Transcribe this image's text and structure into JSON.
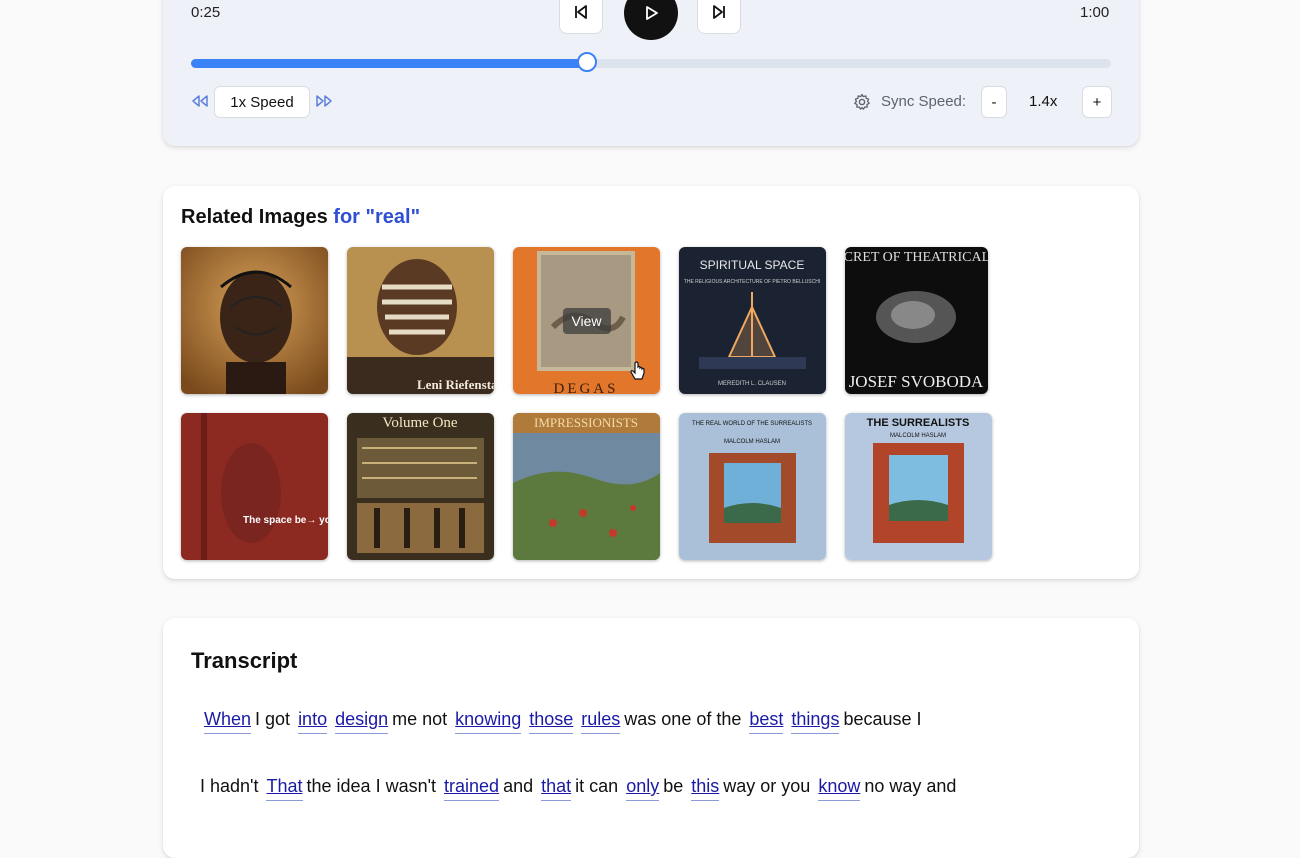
{
  "player": {
    "current_time": "0:25",
    "total_time": "1:00",
    "progress": 0.43,
    "speed_label": "1x Speed",
    "sync_label": "Sync Speed:",
    "sync_minus": "-",
    "sync_value": "1.4x",
    "sync_plus": "+",
    "accent_color": "#3b82f6"
  },
  "images": {
    "title": "Related Images",
    "query": "for \"real\"",
    "hover_label": "View",
    "row1": [
      {
        "title": ""
      },
      {
        "title": "Leni Riefenstahl"
      },
      {
        "title": "DEGAS"
      },
      {
        "title": "SPIRITUAL SPACE",
        "subtitle": "THE RELIGIOUS ARCHITECTURE OF PIETRO BELLUSCHI",
        "author": "MEREDITH L. CLAUSEN"
      },
      {
        "title": "THE SECRET OF THEATRICAL SPACE",
        "author": "JOSEF SVOBODA"
      }
    ],
    "row2": [
      {
        "title": "The space be→ yond"
      },
      {
        "title": "Volume One"
      },
      {
        "title": "IMPRESSIONISTS"
      },
      {
        "title": "THE REAL WORLD OF THE SURREALISTS",
        "author": "MALCOLM HASLAM"
      },
      {
        "title": "THE SURREALISTS",
        "author": "MALCOLM HASLAM"
      }
    ]
  },
  "transcript": {
    "title": "Transcript",
    "lines": [
      [
        {
          "t": "When",
          "link": true
        },
        {
          "t": "I got",
          "link": false
        },
        {
          "t": "into",
          "link": true
        },
        {
          "t": "design",
          "link": true
        },
        {
          "t": "me not",
          "link": false
        },
        {
          "t": "knowing",
          "link": true
        },
        {
          "t": "those",
          "link": true
        },
        {
          "t": "rules",
          "link": true
        },
        {
          "t": "was one of the",
          "link": false
        },
        {
          "t": "best",
          "link": true
        },
        {
          "t": "things",
          "link": true
        },
        {
          "t": "because I",
          "link": false
        }
      ],
      [
        {
          "t": "I hadn't",
          "link": false
        },
        {
          "t": "That",
          "link": true
        },
        {
          "t": "the idea I wasn't",
          "link": false
        },
        {
          "t": "trained",
          "link": true
        },
        {
          "t": "and",
          "link": false
        },
        {
          "t": "that",
          "link": true
        },
        {
          "t": "it can",
          "link": false
        },
        {
          "t": "only",
          "link": true
        },
        {
          "t": "be",
          "link": false
        },
        {
          "t": "this",
          "link": true
        },
        {
          "t": "way or you",
          "link": false
        },
        {
          "t": "know",
          "link": true
        },
        {
          "t": "no way and",
          "link": false
        }
      ]
    ]
  }
}
